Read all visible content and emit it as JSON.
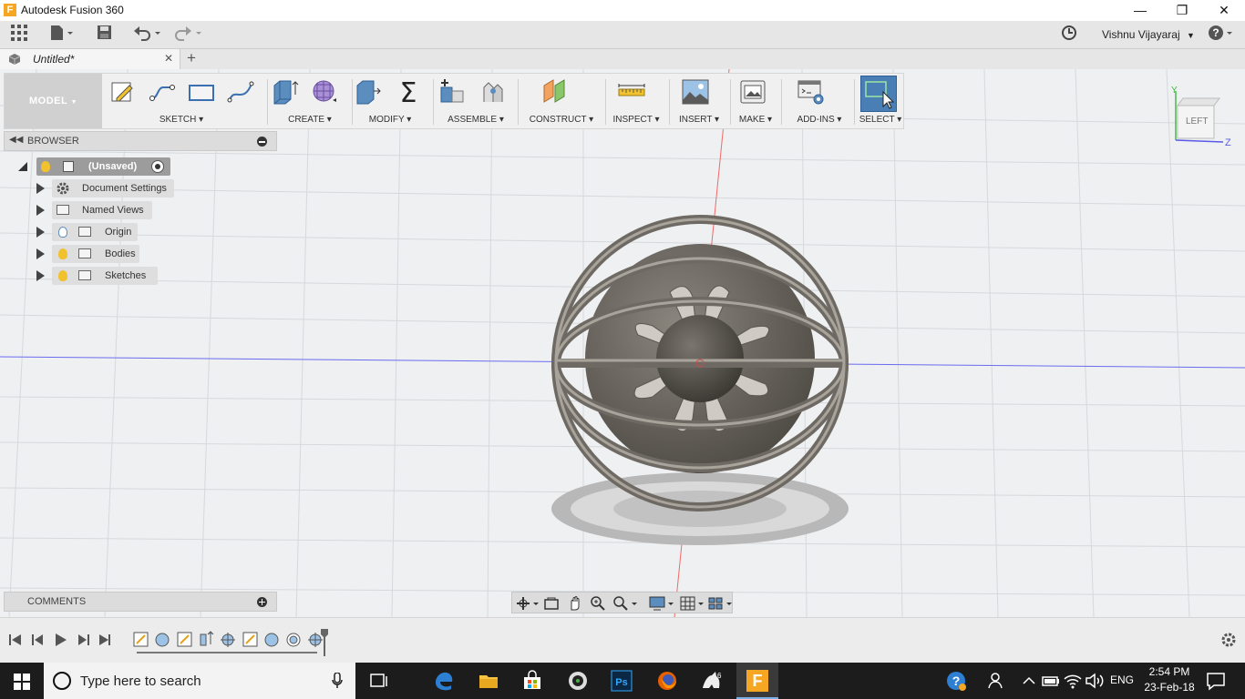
{
  "app": {
    "title": "Autodesk Fusion 360",
    "icon_letter": "F"
  },
  "window": {
    "minimize": "—",
    "restore": "❐",
    "close": "✕"
  },
  "user": {
    "name": "Vishnu Vijayaraj"
  },
  "tab": {
    "label": "Untitled*",
    "close": "✕",
    "new": "+"
  },
  "ribbon": {
    "workspace": "MODEL",
    "groups": [
      {
        "label": "SKETCH"
      },
      {
        "label": "CREATE"
      },
      {
        "label": "MODIFY"
      },
      {
        "label": "ASSEMBLE"
      },
      {
        "label": "CONSTRUCT"
      },
      {
        "label": "INSPECT"
      },
      {
        "label": "INSERT"
      },
      {
        "label": "MAKE"
      },
      {
        "label": "ADD-INS"
      },
      {
        "label": "SELECT"
      }
    ]
  },
  "viewcube": {
    "face": "LEFT",
    "y_axis": "Y",
    "z_axis": "Z"
  },
  "browser": {
    "title": "BROWSER",
    "root": "(Unsaved)",
    "items": [
      {
        "label": "Document Settings",
        "icon": "gear-icon"
      },
      {
        "label": "Named Views",
        "icon": "folder-icon"
      },
      {
        "label": "Origin",
        "icon": "folder-icon",
        "bulb": "off"
      },
      {
        "label": "Bodies",
        "icon": "folder-icon",
        "bulb": "on"
      },
      {
        "label": "Sketches",
        "icon": "folder-icon",
        "bulb": "on"
      }
    ]
  },
  "comments": {
    "title": "COMMENTS"
  },
  "taskbar": {
    "search_placeholder": "Type here to search",
    "lang": "ENG",
    "time": "2:54 PM",
    "date": "23-Feb-18"
  },
  "colors": {
    "accent": "#5b8dbf",
    "select_bg": "#4a7fb5",
    "bulb_on": "#f2c12e",
    "axis_red": "#e04848",
    "axis_blue": "#5a5ae8",
    "axis_green": "#46b846"
  }
}
